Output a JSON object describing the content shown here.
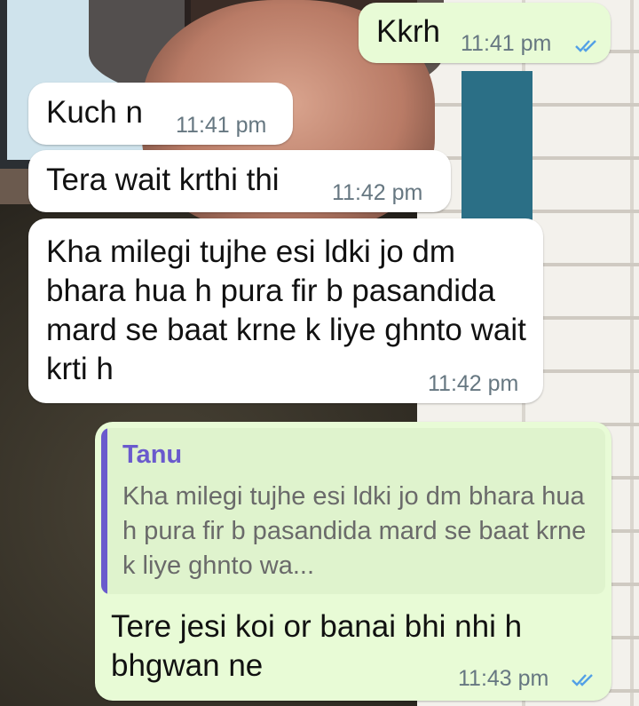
{
  "messages": [
    {
      "id": "m1",
      "direction": "outgoing",
      "text": "Kkrh",
      "time": "11:41 pm",
      "read": true
    },
    {
      "id": "m2",
      "direction": "incoming",
      "text": "Kuch n",
      "time": "11:41 pm"
    },
    {
      "id": "m3",
      "direction": "incoming",
      "text": "Tera wait krthi thi",
      "time": "11:42 pm"
    },
    {
      "id": "m4",
      "direction": "incoming",
      "text": "Kha milegi tujhe esi ldki jo dm bhara hua h pura fir b pasandida mard se baat krne k liye ghnto wait krti h",
      "time": "11:42 pm"
    },
    {
      "id": "m5",
      "direction": "outgoing",
      "text": "Tere jesi koi or banai bhi nhi h bhgwan ne",
      "time": "11:43 pm",
      "read": true,
      "reply_to": {
        "author": "Tanu",
        "text": "Kha milegi tujhe esi ldki jo dm bhara hua h pura fir b pasandida mard se baat krne k liye ghnto wa..."
      }
    }
  ],
  "colors": {
    "incoming": "#ffffff",
    "outgoing": "#e8fbd6",
    "read_ticks": "#53a0e6",
    "quote_accent": "#6a5acd"
  }
}
